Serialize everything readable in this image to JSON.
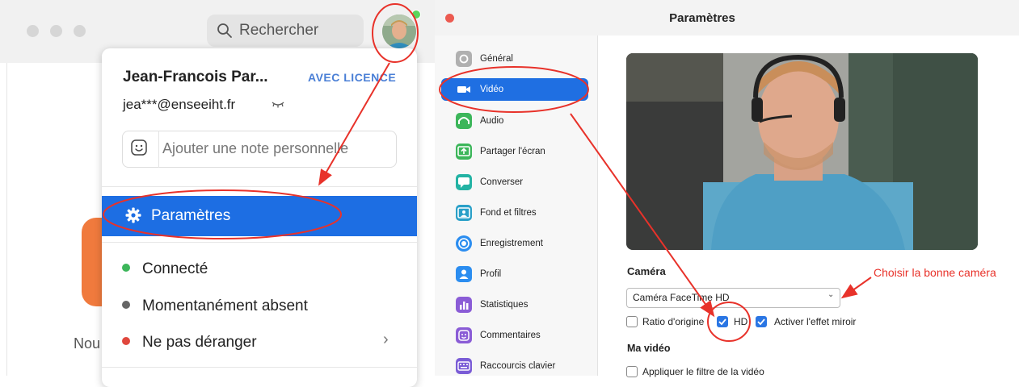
{
  "left": {
    "search": {
      "label": "Rechercher"
    },
    "user": {
      "name": "Jean-Francois Par...",
      "licence": "AVEC LICENCE",
      "email": "jea***@enseeiht.fr",
      "email_icon": "eye-hidden-icon"
    },
    "note": {
      "placeholder": "Ajouter une note personnelle"
    },
    "menu": {
      "settings_label": "Paramètres",
      "statuses": [
        {
          "label": "Connecté",
          "color": "#3cb65a"
        },
        {
          "label": "Momentanément absent",
          "color": "#666666"
        },
        {
          "label": "Ne pas déranger",
          "color": "#e0473d"
        }
      ]
    },
    "partial_text": "Nou"
  },
  "right": {
    "title": "Paramètres",
    "sidebar": [
      {
        "label": "Général",
        "icon": "gear-icon",
        "color": "#b0b0b0"
      },
      {
        "label": "Vidéo",
        "icon": "video-camera-icon",
        "color": "#ffffff",
        "active": true
      },
      {
        "label": "Audio",
        "icon": "headphones-icon",
        "color": "#3cb65a"
      },
      {
        "label": "Partager l'écran",
        "icon": "share-screen-icon",
        "color": "#3cb65a"
      },
      {
        "label": "Converser",
        "icon": "chat-icon",
        "color": "#23b3a4"
      },
      {
        "label": "Fond et filtres",
        "icon": "background-icon",
        "color": "#2aa0c8"
      },
      {
        "label": "Enregistrement",
        "icon": "record-icon",
        "color": "#2b8df0"
      },
      {
        "label": "Profil",
        "icon": "profile-icon",
        "color": "#2b8df0"
      },
      {
        "label": "Statistiques",
        "icon": "statistics-icon",
        "color": "#8a5cd6"
      },
      {
        "label": "Commentaires",
        "icon": "feedback-icon",
        "color": "#8a5cd6"
      },
      {
        "label": "Raccourcis clavier",
        "icon": "keyboard-icon",
        "color": "#7a5cd6"
      }
    ],
    "camera": {
      "heading": "Caméra",
      "selected": "Caméra FaceTime HD",
      "options": [
        {
          "label": "Ratio d'origine",
          "checked": false
        },
        {
          "label": "HD",
          "checked": true
        },
        {
          "label": "Activer l'effet miroir",
          "checked": true
        }
      ]
    },
    "my_video": {
      "heading": "Ma vidéo",
      "filter_label": "Appliquer le filtre de la vidéo",
      "filter_checked": false
    },
    "annotation": "Choisir la bonne caméra"
  },
  "colors": {
    "accent": "#1d6ee3",
    "annotation_red": "#e8322a"
  }
}
